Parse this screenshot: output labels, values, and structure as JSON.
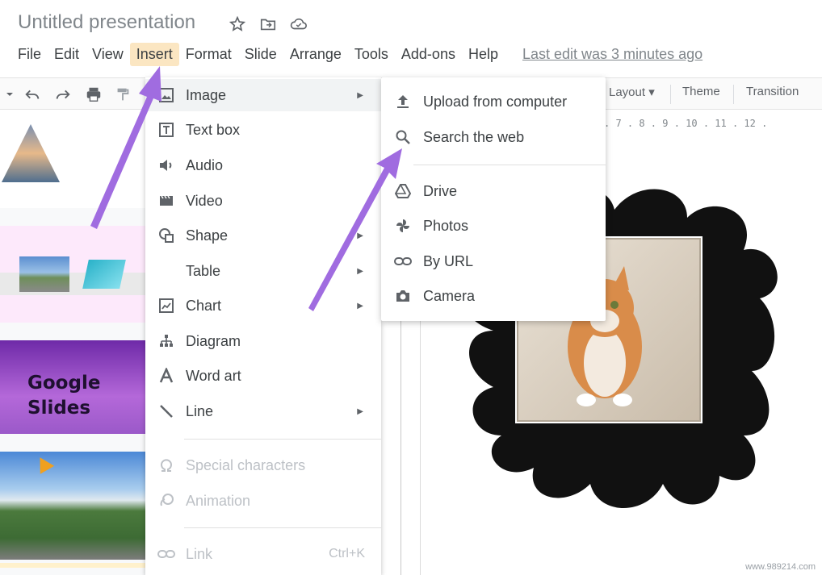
{
  "title": "Untitled presentation",
  "title_icons": [
    "star-icon",
    "folder-move-icon",
    "cloud-saved-icon"
  ],
  "menubar": {
    "items": [
      {
        "label": "File",
        "active": false
      },
      {
        "label": "Edit",
        "active": false
      },
      {
        "label": "View",
        "active": false
      },
      {
        "label": "Insert",
        "active": true
      },
      {
        "label": "Format",
        "active": false
      },
      {
        "label": "Slide",
        "active": false
      },
      {
        "label": "Arrange",
        "active": false
      },
      {
        "label": "Tools",
        "active": false
      },
      {
        "label": "Add-ons",
        "active": false
      },
      {
        "label": "Help",
        "active": false
      }
    ],
    "last_edit": "Last edit was 3 minutes ago"
  },
  "toolbar": {
    "layout_label": "Layout",
    "theme_label": "Theme",
    "transition_label": "Transition"
  },
  "ruler": ". 7 . 8 . 9 . 10 . 11 . 12 .",
  "insert_menu": {
    "items": [
      {
        "label": "Image",
        "icon": "image-icon",
        "submenu": true,
        "disabled": false,
        "hover": true
      },
      {
        "label": "Text box",
        "icon": "text-box-icon",
        "submenu": false,
        "disabled": false
      },
      {
        "label": "Audio",
        "icon": "audio-icon",
        "submenu": false,
        "disabled": false
      },
      {
        "label": "Video",
        "icon": "video-icon",
        "submenu": false,
        "disabled": false
      },
      {
        "label": "Shape",
        "icon": "shape-icon",
        "submenu": true,
        "disabled": false
      },
      {
        "label": "Table",
        "icon": "",
        "submenu": true,
        "disabled": false
      },
      {
        "label": "Chart",
        "icon": "chart-icon",
        "submenu": true,
        "disabled": false
      },
      {
        "label": "Diagram",
        "icon": "diagram-icon",
        "submenu": false,
        "disabled": false
      },
      {
        "label": "Word art",
        "icon": "word-art-icon",
        "submenu": false,
        "disabled": false
      },
      {
        "label": "Line",
        "icon": "line-icon",
        "submenu": true,
        "disabled": false
      },
      {
        "label": "Special characters",
        "icon": "omega-icon",
        "submenu": false,
        "disabled": true
      },
      {
        "label": "Animation",
        "icon": "animation-icon",
        "submenu": false,
        "disabled": true
      },
      {
        "label": "Link",
        "icon": "link-icon",
        "submenu": false,
        "disabled": true,
        "shortcut": "Ctrl+K"
      }
    ]
  },
  "image_submenu": {
    "items": [
      {
        "label": "Upload from computer",
        "icon": "upload-icon"
      },
      {
        "label": "Search the web",
        "icon": "search-icon"
      },
      {
        "label": "Drive",
        "icon": "drive-icon"
      },
      {
        "label": "Photos",
        "icon": "photos-pinwheel-icon"
      },
      {
        "label": "By URL",
        "icon": "link-icon"
      },
      {
        "label": "Camera",
        "icon": "camera-icon"
      }
    ]
  },
  "slide_thumbnail_text": {
    "line1": "Google",
    "line2": "Slides"
  },
  "watermark": "www.989214.com",
  "colors": {
    "accent_purple": "#a06ce0",
    "menu_active_bg": "#fbe6c2",
    "hover_bg": "#f1f3f4"
  }
}
